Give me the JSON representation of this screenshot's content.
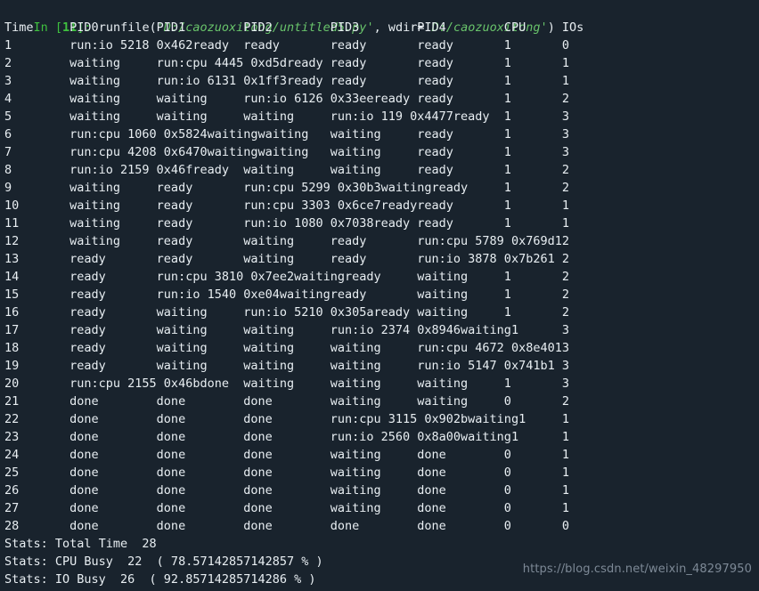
{
  "console": {
    "prompt": {
      "in_label": "In [",
      "number": "11",
      "close_label": "]:"
    },
    "command": {
      "func_open": " runfile(",
      "arg1_quote_open": "'",
      "arg1": "D:/caozuoxitong/untitled5.py",
      "arg1_quote_close": "'",
      "separator": ", wdir=",
      "arg2_quote_open": "'",
      "arg2": "D:/caozuoxitong",
      "arg2_quote_close": "'",
      "func_close": ")"
    }
  },
  "table": {
    "columns": [
      "Time",
      "PID0",
      "PID1",
      "PID2",
      "PID3",
      "PID4",
      "CPU",
      "IOs"
    ],
    "column_starts": [
      0,
      9,
      21,
      33,
      45,
      57,
      69,
      77
    ],
    "header_line": "Time     PID0        PID1        PID2        PID3        PID4        CPU     IOs",
    "rows": [
      {
        "time": "1",
        "pid0": "run:io 5218 0x462",
        "pid1": "ready",
        "pid2": "ready",
        "pid3": "ready",
        "pid4": "ready",
        "cpu": "1",
        "ios": "0"
      },
      {
        "time": "2",
        "pid0": "waiting",
        "pid1": "run:cpu 4445 0xd5d",
        "pid2": "ready",
        "pid3": "ready",
        "pid4": "ready",
        "cpu": "1",
        "ios": "1"
      },
      {
        "time": "3",
        "pid0": "waiting",
        "pid1": "run:io 6131 0x1ff3",
        "pid2": "ready",
        "pid3": "ready",
        "pid4": "ready",
        "cpu": "1",
        "ios": "1"
      },
      {
        "time": "4",
        "pid0": "waiting",
        "pid1": "waiting",
        "pid2": "run:io 6126 0x33ee",
        "pid3": "ready",
        "pid4": "ready",
        "cpu": "1",
        "ios": "2"
      },
      {
        "time": "5",
        "pid0": "waiting",
        "pid1": "waiting",
        "pid2": "waiting",
        "pid3": "run:io 119 0x4477",
        "pid4": "ready",
        "cpu": "1",
        "ios": "3"
      },
      {
        "time": "6",
        "pid0": "run:cpu 1060 0x5824",
        "pid1": "waiting",
        "pid2": "waiting",
        "pid3": "waiting",
        "pid4": "ready",
        "cpu": "1",
        "ios": "3"
      },
      {
        "time": "7",
        "pid0": "run:cpu 4208 0x6470",
        "pid1": "waiting",
        "pid2": "waiting",
        "pid3": "waiting",
        "pid4": "ready",
        "cpu": "1",
        "ios": "3"
      },
      {
        "time": "8",
        "pid0": "run:io 2159 0x46f",
        "pid1": "ready",
        "pid2": "waiting",
        "pid3": "waiting",
        "pid4": "ready",
        "cpu": "1",
        "ios": "2"
      },
      {
        "time": "9",
        "pid0": "waiting",
        "pid1": "ready",
        "pid2": "run:cpu 5299 0x30b3",
        "pid3": "waiting",
        "pid4": "ready",
        "cpu": "1",
        "ios": "2"
      },
      {
        "time": "10",
        "pid0": "waiting",
        "pid1": "ready",
        "pid2": "run:cpu 3303 0x6ce7",
        "pid3": "ready",
        "pid4": "ready",
        "cpu": "1",
        "ios": "1"
      },
      {
        "time": "11",
        "pid0": "waiting",
        "pid1": "ready",
        "pid2": "run:io 1080 0x7038",
        "pid3": "ready",
        "pid4": "ready",
        "cpu": "1",
        "ios": "1"
      },
      {
        "time": "12",
        "pid0": "waiting",
        "pid1": "ready",
        "pid2": "waiting",
        "pid3": "ready",
        "pid4": "run:cpu 5789 0x769d",
        "cpu": "1",
        "ios": "2"
      },
      {
        "time": "13",
        "pid0": "ready",
        "pid1": "ready",
        "pid2": "waiting",
        "pid3": "ready",
        "pid4": "run:io 3878 0x7b26",
        "cpu": "1",
        "ios": "2"
      },
      {
        "time": "14",
        "pid0": "ready",
        "pid1": "run:cpu 3810 0x7ee2",
        "pid2": "waiting",
        "pid3": "ready",
        "pid4": "waiting",
        "cpu": "1",
        "ios": "2"
      },
      {
        "time": "15",
        "pid0": "ready",
        "pid1": "run:io 1540 0xe04",
        "pid2": "waiting",
        "pid3": "ready",
        "pid4": "waiting",
        "cpu": "1",
        "ios": "2"
      },
      {
        "time": "16",
        "pid0": "ready",
        "pid1": "waiting",
        "pid2": "run:io 5210 0x305a",
        "pid3": "ready",
        "pid4": "waiting",
        "cpu": "1",
        "ios": "2"
      },
      {
        "time": "17",
        "pid0": "ready",
        "pid1": "waiting",
        "pid2": "waiting",
        "pid3": "run:io 2374 0x8946",
        "pid4": "waiting",
        "cpu": "1",
        "ios": "3"
      },
      {
        "time": "18",
        "pid0": "ready",
        "pid1": "waiting",
        "pid2": "waiting",
        "pid3": "waiting",
        "pid4": "run:cpu 4672 0x8e40",
        "cpu": "1",
        "ios": "3"
      },
      {
        "time": "19",
        "pid0": "ready",
        "pid1": "waiting",
        "pid2": "waiting",
        "pid3": "waiting",
        "pid4": "run:io 5147 0x741b",
        "cpu": "1",
        "ios": "3"
      },
      {
        "time": "20",
        "pid0": "run:cpu 2155 0x46b",
        "pid1": "done",
        "pid2": "waiting",
        "pid3": "waiting",
        "pid4": "waiting",
        "cpu": "1",
        "ios": "3"
      },
      {
        "time": "21",
        "pid0": "done",
        "pid1": "done",
        "pid2": "done",
        "pid3": "waiting",
        "pid4": "waiting",
        "cpu": "0",
        "ios": "2"
      },
      {
        "time": "22",
        "pid0": "done",
        "pid1": "done",
        "pid2": "done",
        "pid3": "run:cpu 3115 0x902b",
        "pid4": "waiting",
        "cpu": "1",
        "ios": "1"
      },
      {
        "time": "23",
        "pid0": "done",
        "pid1": "done",
        "pid2": "done",
        "pid3": "run:io 2560 0x8a00",
        "pid4": "waiting",
        "cpu": "1",
        "ios": "1"
      },
      {
        "time": "24",
        "pid0": "done",
        "pid1": "done",
        "pid2": "done",
        "pid3": "waiting",
        "pid4": "done",
        "cpu": "0",
        "ios": "1"
      },
      {
        "time": "25",
        "pid0": "done",
        "pid1": "done",
        "pid2": "done",
        "pid3": "waiting",
        "pid4": "done",
        "cpu": "0",
        "ios": "1"
      },
      {
        "time": "26",
        "pid0": "done",
        "pid1": "done",
        "pid2": "done",
        "pid3": "waiting",
        "pid4": "done",
        "cpu": "0",
        "ios": "1"
      },
      {
        "time": "27",
        "pid0": "done",
        "pid1": "done",
        "pid2": "done",
        "pid3": "waiting",
        "pid4": "done",
        "cpu": "0",
        "ios": "1"
      },
      {
        "time": "28",
        "pid0": "done",
        "pid1": "done",
        "pid2": "done",
        "pid3": "done",
        "pid4": "done",
        "cpu": "0",
        "ios": "0"
      }
    ]
  },
  "stats": [
    "Stats: Total Time  28",
    "Stats: CPU Busy  22  ( 78.57142857142857 % )",
    "Stats: IO Busy  26  ( 92.85714285714286 % )"
  ],
  "watermark": {
    "text": "https://blog.csdn.net/weixin_48297950"
  },
  "colors": {
    "background": "#19232d",
    "text": "#e8eef2",
    "prompt_green": "#3fc13f",
    "string_green": "#69c46b",
    "watermark_gray": "#7d8996"
  }
}
